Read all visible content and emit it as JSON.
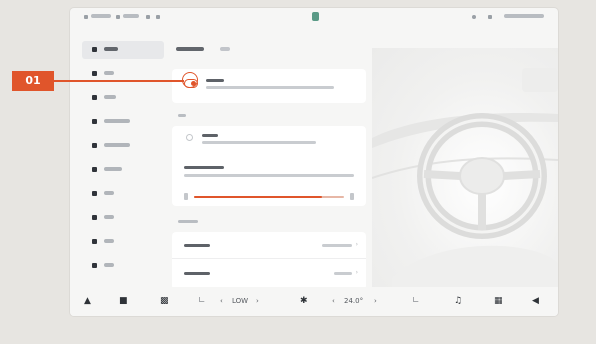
{
  "statusbar": {
    "left_items": [
      "",
      "",
      "",
      ""
    ],
    "right_text": ""
  },
  "sidebar": {
    "items": [
      {
        "label": "",
        "active": true,
        "icon": "car-icon"
      },
      {
        "label": "",
        "active": false,
        "icon": "seat-icon"
      },
      {
        "label": "",
        "active": false,
        "icon": "light-icon"
      },
      {
        "label": "",
        "active": false,
        "icon": "display-icon"
      },
      {
        "label": "",
        "active": false,
        "icon": "drive-assist-icon"
      },
      {
        "label": "",
        "active": false,
        "icon": "charging-icon"
      },
      {
        "label": "",
        "active": false,
        "icon": "key-icon"
      },
      {
        "label": "",
        "active": false,
        "icon": "sound-icon"
      },
      {
        "label": "",
        "active": false,
        "icon": "connectivity-icon"
      },
      {
        "label": "",
        "active": false,
        "icon": "system-icon"
      }
    ]
  },
  "tabs": [
    {
      "label": "",
      "active": true
    },
    {
      "label": "",
      "active": false
    }
  ],
  "settings": {
    "feature_toggle": {
      "title": "",
      "desc": "",
      "enabled": true
    },
    "section1_label": "",
    "option1": {
      "title": "",
      "desc": ""
    },
    "slider_setting": {
      "title": "",
      "desc": "",
      "value": 0.85
    },
    "section2_label": "",
    "rows": [
      {
        "label": "",
        "value": ""
      },
      {
        "label": "",
        "value": ""
      }
    ]
  },
  "dock": {
    "fan_level": "LOW",
    "temperature": "24.0°"
  },
  "callout": {
    "label": "01"
  },
  "accent_color": "#e0552b"
}
